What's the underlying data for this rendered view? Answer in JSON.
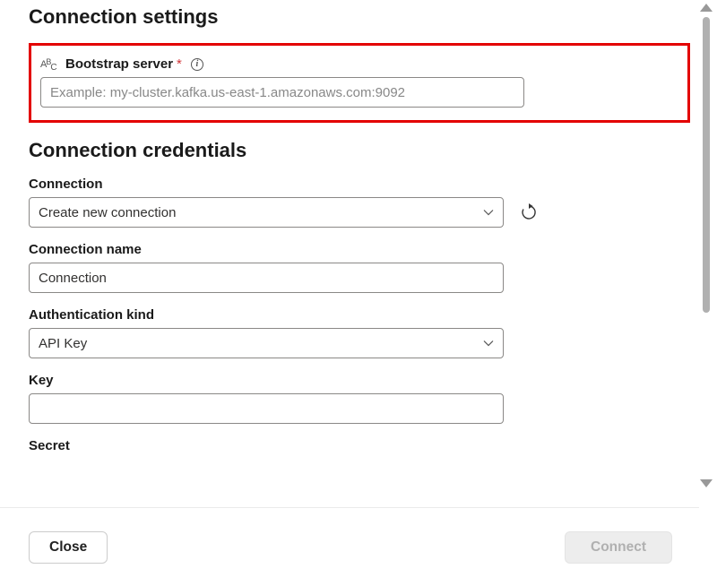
{
  "settings": {
    "heading": "Connection settings",
    "bootstrap": {
      "label": "Bootstrap server",
      "required_mark": "*",
      "placeholder": "Example: my-cluster.kafka.us-east-1.amazonaws.com:9092",
      "value": ""
    }
  },
  "credentials": {
    "heading": "Connection credentials",
    "connection": {
      "label": "Connection",
      "value": "Create new connection"
    },
    "connection_name": {
      "label": "Connection name",
      "value": "Connection"
    },
    "auth_kind": {
      "label": "Authentication kind",
      "value": "API Key"
    },
    "key": {
      "label": "Key",
      "value": ""
    },
    "secret": {
      "label": "Secret"
    }
  },
  "footer": {
    "close": "Close",
    "connect": "Connect"
  }
}
